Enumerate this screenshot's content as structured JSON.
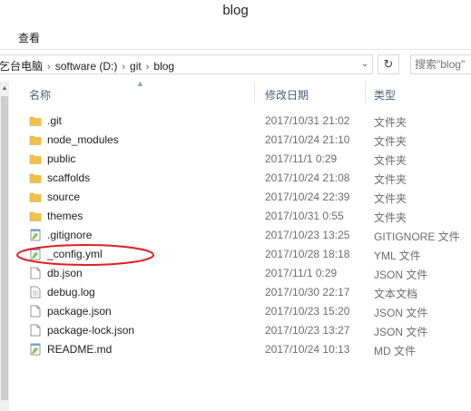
{
  "window": {
    "title": "blog"
  },
  "ribbon": {
    "tab_view": "查看"
  },
  "address": {
    "crumbs": [
      "乞台电脑",
      "software (D:)",
      "git",
      "blog"
    ],
    "separator": "›"
  },
  "search": {
    "placeholder": "搜索\"blog\""
  },
  "columns": {
    "name": "名称",
    "date": "修改日期",
    "type": "类型"
  },
  "files": [
    {
      "name": ".git",
      "date": "2017/10/31 21:02",
      "type": "文件夹",
      "icon": "folder-icon"
    },
    {
      "name": "node_modules",
      "date": "2017/10/24 21:10",
      "type": "文件夹",
      "icon": "folder-icon"
    },
    {
      "name": "public",
      "date": "2017/11/1 0:29",
      "type": "文件夹",
      "icon": "folder-icon"
    },
    {
      "name": "scaffolds",
      "date": "2017/10/24 21:08",
      "type": "文件夹",
      "icon": "folder-icon"
    },
    {
      "name": "source",
      "date": "2017/10/24 22:39",
      "type": "文件夹",
      "icon": "folder-icon"
    },
    {
      "name": "themes",
      "date": "2017/10/31 0:55",
      "type": "文件夹",
      "icon": "folder-icon"
    },
    {
      "name": ".gitignore",
      "date": "2017/10/23 13:25",
      "type": "GITIGNORE 文件",
      "icon": "notepad-file-icon"
    },
    {
      "name": "_config.yml",
      "date": "2017/10/28 18:18",
      "type": "YML 文件",
      "icon": "notepad-file-icon"
    },
    {
      "name": "db.json",
      "date": "2017/11/1 0:29",
      "type": "JSON 文件",
      "icon": "blank-file-icon"
    },
    {
      "name": "debug.log",
      "date": "2017/10/30 22:17",
      "type": "文本文档",
      "icon": "text-file-icon"
    },
    {
      "name": "package.json",
      "date": "2017/10/23 15:20",
      "type": "JSON 文件",
      "icon": "blank-file-icon"
    },
    {
      "name": "package-lock.json",
      "date": "2017/10/23 13:27",
      "type": "JSON 文件",
      "icon": "blank-file-icon"
    },
    {
      "name": "README.md",
      "date": "2017/10/24 10:13",
      "type": "MD 文件",
      "icon": "notepad-file-icon"
    }
  ],
  "annotation": {
    "highlighted_file": "_config.yml",
    "color": "#e02020"
  },
  "colors": {
    "folder": "#f0c24a",
    "header_text": "#4c607a",
    "secondary_text": "#6d6d6d"
  }
}
